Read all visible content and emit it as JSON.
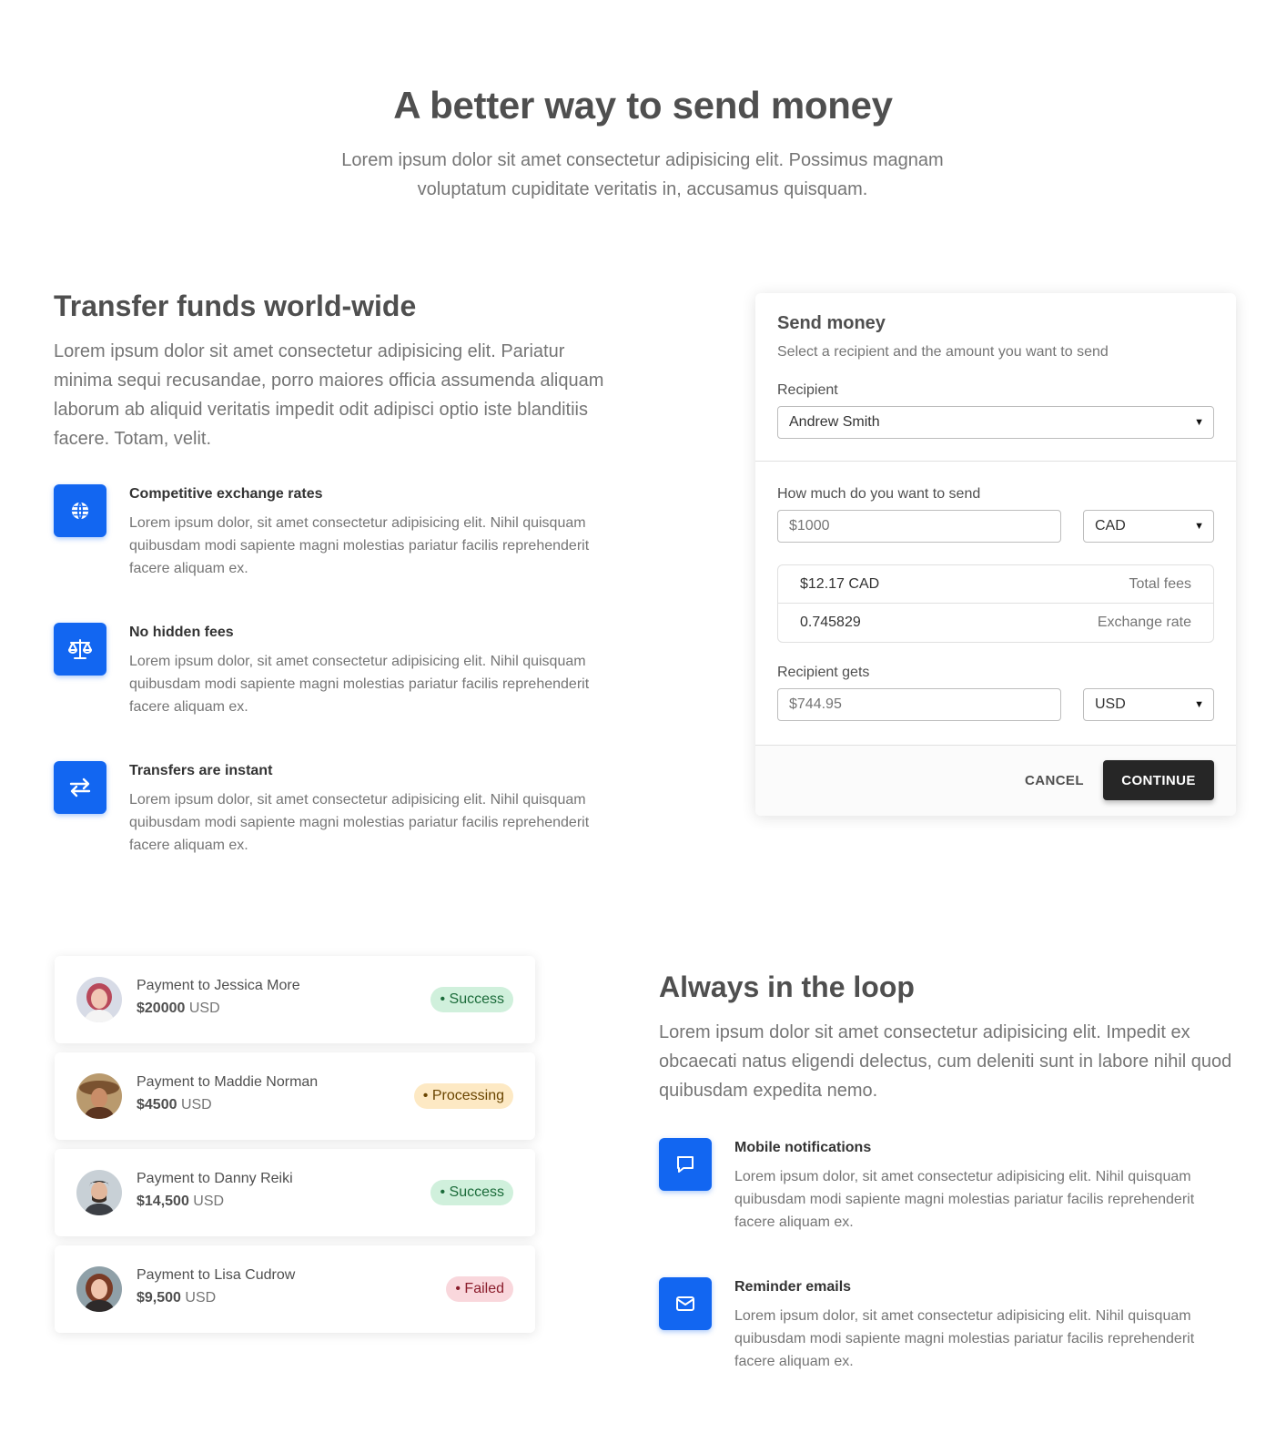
{
  "hero": {
    "title": "A better way to send money",
    "subtitle": "Lorem ipsum dolor sit amet consectetur adipisicing elit. Possimus magnam voluptatum cupiditate veritatis in, accusamus quisquam."
  },
  "transfer": {
    "title": "Transfer funds world-wide",
    "text": "Lorem ipsum dolor sit amet consectetur adipisicing elit. Pariatur minima sequi recusandae, porro maiores officia assumenda aliquam laborum ab aliquid veritatis impedit odit adipisci optio iste blanditiis facere. Totam, velit.",
    "features": [
      {
        "icon": "globe-icon",
        "title": "Competitive exchange rates",
        "text": "Lorem ipsum dolor, sit amet consectetur adipisicing elit. Nihil quisquam quibusdam modi sapiente magni molestias pariatur facilis reprehenderit facere aliquam ex."
      },
      {
        "icon": "scale-icon",
        "title": "No hidden fees",
        "text": "Lorem ipsum dolor, sit amet consectetur adipisicing elit. Nihil quisquam quibusdam modi sapiente magni molestias pariatur facilis reprehenderit facere aliquam ex."
      },
      {
        "icon": "exchange-arrows-icon",
        "title": "Transfers are instant",
        "text": "Lorem ipsum dolor, sit amet consectetur adipisicing elit. Nihil quisquam quibusdam modi sapiente magni molestias pariatur facilis reprehenderit facere aliquam ex."
      }
    ]
  },
  "send_card": {
    "title": "Send money",
    "subtitle": "Select a recipient and the amount you want to send",
    "recipient_label": "Recipient",
    "recipient_value": "Andrew Smith",
    "amount_label": "How much do you want to send",
    "amount_placeholder": "$1000",
    "amount_currency": "CAD",
    "fees_value": "$12.17 CAD",
    "fees_label": "Total fees",
    "rate_value": "0.745829",
    "rate_label": "Exchange rate",
    "gets_label": "Recipient gets",
    "gets_placeholder": "$744.95",
    "gets_currency": "USD",
    "cancel_label": "CANCEL",
    "continue_label": "CONTINUE"
  },
  "payments": [
    {
      "title": "Payment to Jessica More",
      "amount": "$20000",
      "currency": "USD",
      "status": "• Success",
      "status_type": "success"
    },
    {
      "title": "Payment to Maddie Norman",
      "amount": "$4500",
      "currency": "USD",
      "status": "• Processing",
      "status_type": "processing"
    },
    {
      "title": "Payment to Danny Reiki",
      "amount": "$14,500",
      "currency": "USD",
      "status": "• Success",
      "status_type": "success"
    },
    {
      "title": "Payment to Lisa Cudrow",
      "amount": "$9,500",
      "currency": "USD",
      "status": "• Failed",
      "status_type": "failed"
    }
  ],
  "loop": {
    "title": "Always in the loop",
    "text": "Lorem ipsum dolor sit amet consectetur adipisicing elit. Impedit ex obcaecati natus eligendi delectus, cum deleniti sunt in labore nihil quod quibusdam expedita nemo.",
    "features": [
      {
        "icon": "message-icon",
        "title": "Mobile notifications",
        "text": "Lorem ipsum dolor, sit amet consectetur adipisicing elit. Nihil quisquam quibusdam modi sapiente magni molestias pariatur facilis reprehenderit facere aliquam ex."
      },
      {
        "icon": "envelope-icon",
        "title": "Reminder emails",
        "text": "Lorem ipsum dolor, sit amet consectetur adipisicing elit. Nihil quisquam quibusdam modi sapiente magni molestias pariatur facilis reprehenderit facere aliquam ex."
      }
    ]
  },
  "colors": {
    "accent": "#1266f1",
    "dark_button": "#262626",
    "text": "#4f4f4f",
    "muted": "#757575"
  }
}
